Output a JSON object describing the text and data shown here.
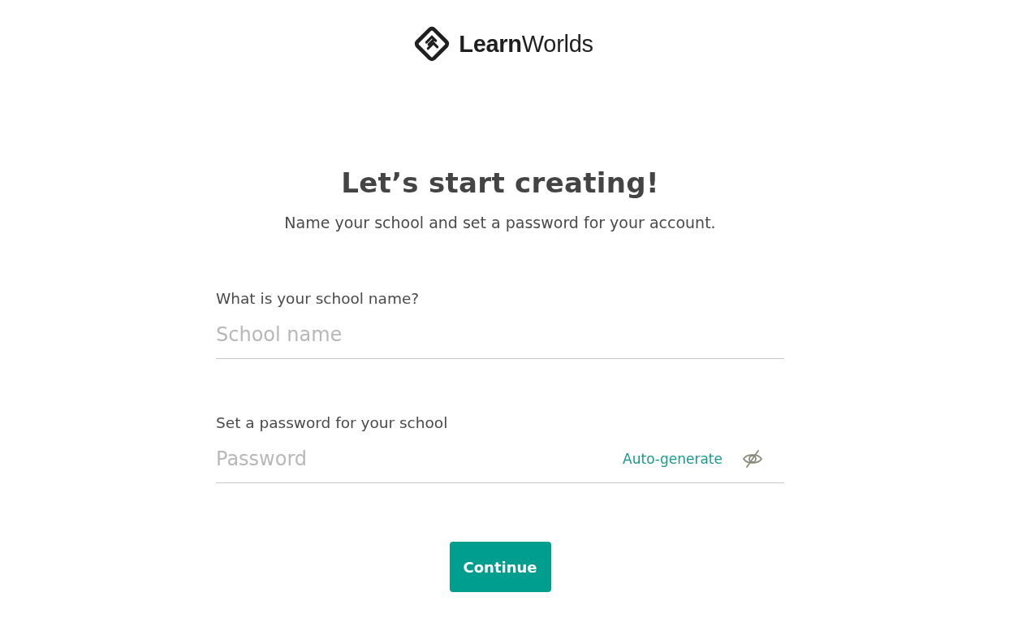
{
  "logo": {
    "text": "**Learn**Worlds"
  },
  "heading": "Let’s start creating!",
  "subtitle": "Name your school and set a password for your account.",
  "fields": [
    {
      "kind": "text",
      "label": "What is your school name?",
      "placeholder": "School name"
    },
    {
      "kind": "password",
      "label": "Set a password for your school",
      "placeholder": "Password",
      "action": "Auto-generate",
      "visible": false
    }
  ],
  "button": {
    "label": "Continue"
  }
}
